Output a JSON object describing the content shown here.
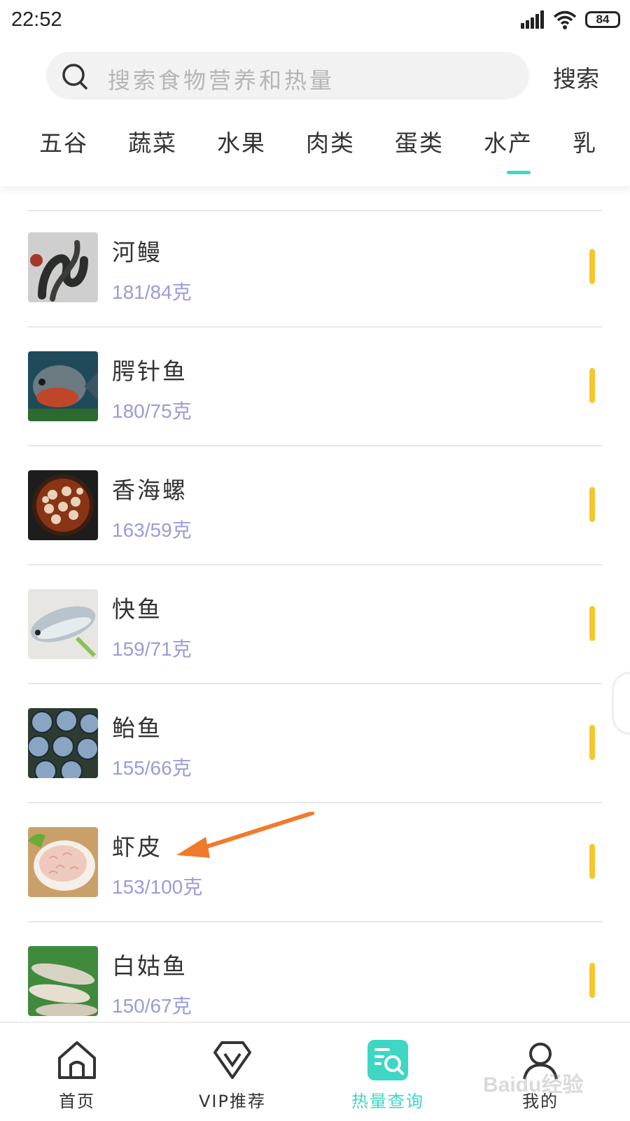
{
  "status_bar": {
    "time": "22:52",
    "battery": "84"
  },
  "search": {
    "placeholder": "搜索食物营养和热量",
    "button_label": "搜索"
  },
  "tabs": [
    {
      "label": "五谷"
    },
    {
      "label": "蔬菜"
    },
    {
      "label": "水果"
    },
    {
      "label": "肉类"
    },
    {
      "label": "蛋类"
    },
    {
      "label": "水产",
      "active": true
    },
    {
      "label": "乳"
    }
  ],
  "foods": [
    {
      "name": "河鳗",
      "calories": "181/84克",
      "image": "eel-photo"
    },
    {
      "name": "腭针鱼",
      "calories": "180/75克",
      "image": "fish-photo"
    },
    {
      "name": "香海螺",
      "calories": "163/59克",
      "image": "snail-photo"
    },
    {
      "name": "快鱼",
      "calories": "159/71克",
      "image": "fish-photo"
    },
    {
      "name": "鲐鱼",
      "calories": "155/66克",
      "image": "mackerel-photo"
    },
    {
      "name": "虾皮",
      "calories": "153/100克",
      "image": "shrimp-photo"
    },
    {
      "name": "白姑鱼",
      "calories": "150/67克",
      "image": "fish-photo"
    }
  ],
  "bottom_nav": [
    {
      "label": "首页",
      "icon": "home-icon"
    },
    {
      "label": "VIP推荐",
      "icon": "vip-icon"
    },
    {
      "label": "热量查询",
      "icon": "calorie-search-icon",
      "active": true
    },
    {
      "label": "我的",
      "icon": "profile-icon"
    }
  ],
  "watermark": "Baidu经验",
  "colors": {
    "accent": "#3fd6c3",
    "calorie_text": "#9b9bd8",
    "marker": "#f6c72c",
    "annotation": "#f07a2c"
  }
}
